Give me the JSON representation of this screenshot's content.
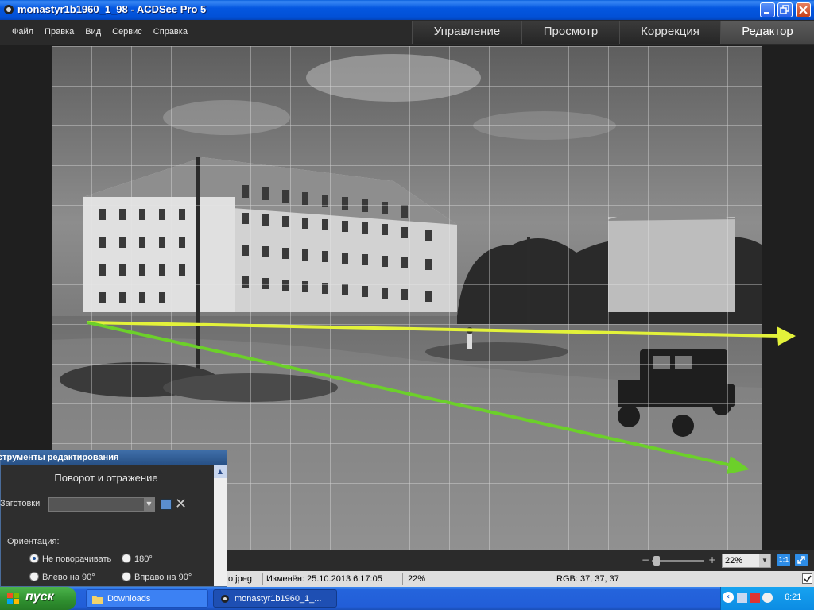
{
  "window": {
    "title": "monastyr1b1960_1_98 - ACDSee Pro 5"
  },
  "menu": [
    "Файл",
    "Правка",
    "Вид",
    "Сервис",
    "Справка"
  ],
  "mode_tabs": [
    {
      "label": "Управление",
      "active": false
    },
    {
      "label": "Просмотр",
      "active": false
    },
    {
      "label": "Коррекция",
      "active": false
    },
    {
      "label": "Редактор",
      "active": true
    }
  ],
  "viewer": {
    "zoom_value": "22%",
    "zoom_minus": "−",
    "zoom_plus": "+",
    "actual_size_label": "1:1"
  },
  "status": {
    "type": "о jpeg",
    "modified": "Изменён: 25.10.2013 6:17:05",
    "zoom": "22%",
    "rgb": "RGB: 37, 37, 37"
  },
  "edit_panel": {
    "header": "струменты редактирования",
    "title": "Поворот и отражение",
    "presets_label": "Заготовки",
    "presets_value": "",
    "orientation_label": "Ориентация:",
    "options": [
      {
        "label": "Не поворачивать",
        "selected": true
      },
      {
        "label": "180°",
        "selected": false
      },
      {
        "label": "Влево на 90°",
        "selected": false
      },
      {
        "label": "Вправо на 90°",
        "selected": false
      }
    ]
  },
  "taskbar": {
    "start_label": "пуск",
    "tasks": [
      {
        "label": "Downloads",
        "active": false
      },
      {
        "label": "monastyr1b1960_1_...",
        "active": true
      }
    ],
    "clock": "6:21"
  },
  "overlay": {
    "grid": true,
    "arrow_colors": [
      "#e3f23a",
      "#6cd02a"
    ]
  },
  "icons": [
    "acdsee-app-icon",
    "minimize-icon",
    "maximize-icon",
    "close-icon",
    "save-icon",
    "delete-icon",
    "windows-logo-icon",
    "folder-icon"
  ]
}
